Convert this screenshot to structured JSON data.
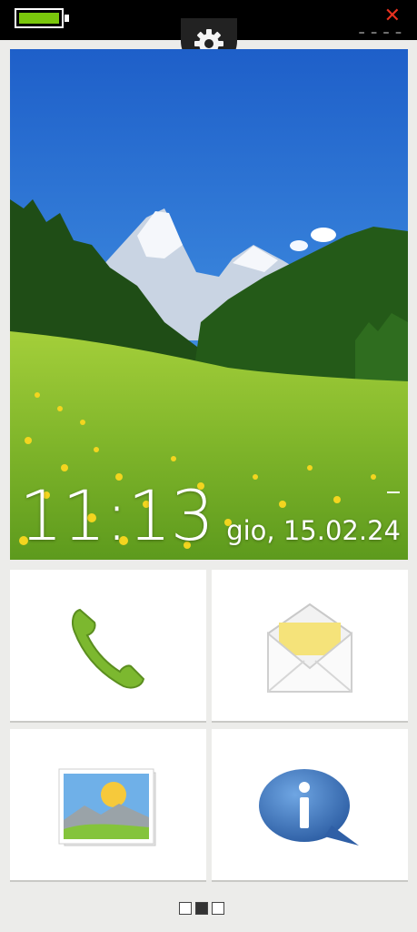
{
  "status_bar": {
    "battery_level": 1.0,
    "battery_color": "#7ac70c",
    "close_icon": "close-icon",
    "close_color": "#e8321f"
  },
  "settings": {
    "icon": "gear-icon"
  },
  "home": {
    "time": "11:13",
    "date": "gio, 15.02.24"
  },
  "tiles": [
    {
      "id": "phone",
      "icon": "phone-icon"
    },
    {
      "id": "messages",
      "icon": "envelope-icon"
    },
    {
      "id": "gallery",
      "icon": "picture-icon"
    },
    {
      "id": "info",
      "icon": "info-bubble-icon"
    }
  ],
  "pager": {
    "pages": 3,
    "current": 2
  }
}
